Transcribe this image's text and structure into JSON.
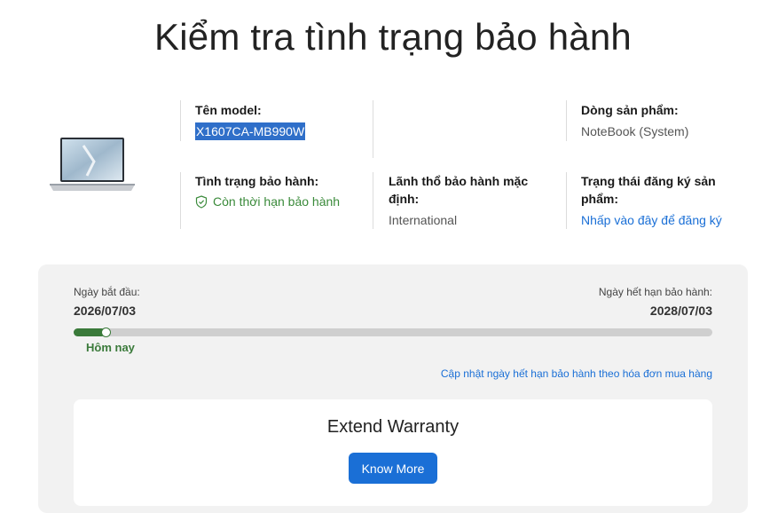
{
  "page": {
    "title": "Kiểm tra tình trạng bảo hành"
  },
  "product": {
    "model_label": "Tên model:",
    "model_value": "X1607CA-MB990W",
    "line_label": "Dòng sản phẩm:",
    "line_value": "NoteBook (System)",
    "warranty_status_label": "Tình trạng bảo hành:",
    "warranty_status_value": "Còn thời hạn bảo hành",
    "territory_label_1": "Lãnh thổ bảo hành mặc",
    "territory_label_2": "định:",
    "territory_value": "International",
    "registration_label_1": "Trạng thái đăng ký sản",
    "registration_label_2": "phẩm:",
    "registration_link": "Nhấp vào đây để đăng ký"
  },
  "warranty_period": {
    "start_label": "Ngày bắt đầu:",
    "start_date": "2026/07/03",
    "end_label": "Ngày hết hạn bảo hành:",
    "end_date": "2028/07/03",
    "progress_fraction": 0.05,
    "today_label": "Hôm nay",
    "update_link": "Cập nhật ngày hết hạn bảo hành theo hóa đơn mua hàng"
  },
  "extend": {
    "title": "Extend Warranty",
    "button_label": "Know More"
  },
  "colors": {
    "accent": "#1a6fd6",
    "ok_green": "#3a8a3a",
    "progress_green": "#3a7a3a"
  }
}
